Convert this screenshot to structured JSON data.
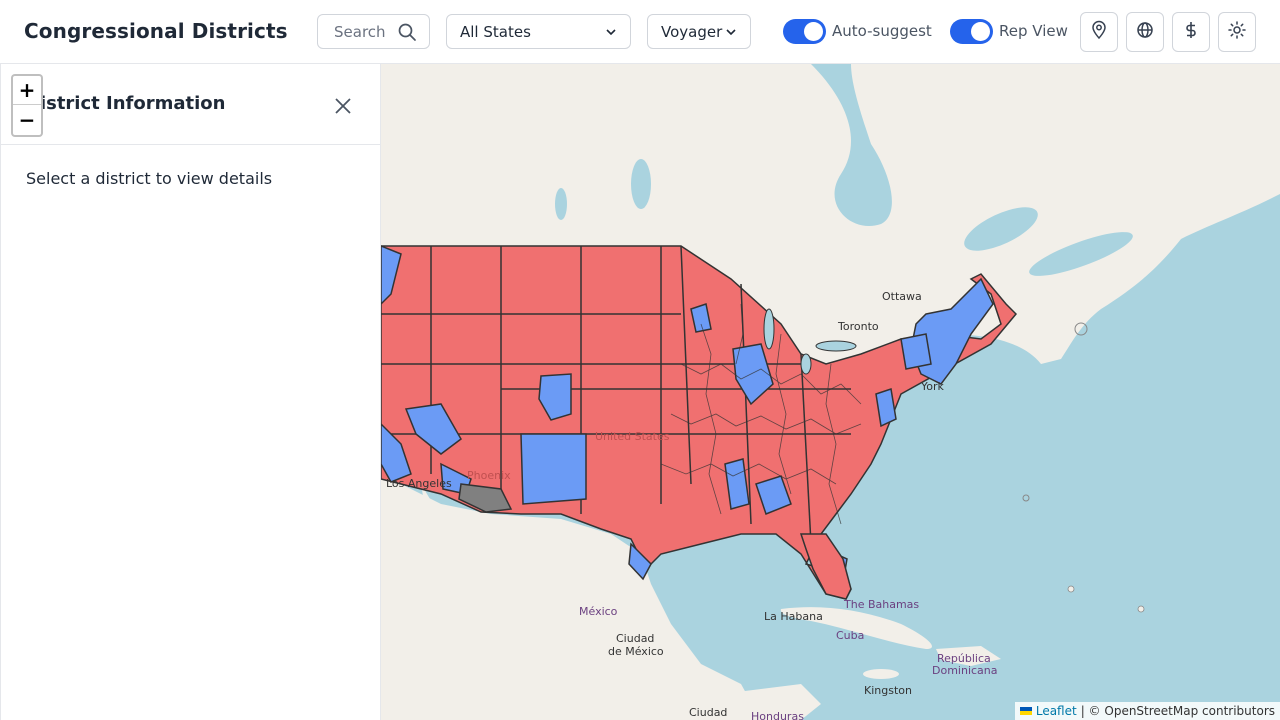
{
  "header": {
    "title": "Congressional Districts",
    "search_placeholder": "Search",
    "state_select": "All States",
    "basemap_select": "Voyager",
    "toggle_autosuggest": "Auto-suggest",
    "toggle_repview": "Rep View",
    "icons": [
      "map-pin-icon",
      "globe-icon",
      "dollar-icon",
      "sun-icon"
    ]
  },
  "sidebar": {
    "title": "District Information",
    "empty_text": "Select a district to view details",
    "zoom_in": "+",
    "zoom_out": "−"
  },
  "map": {
    "labels": {
      "ottawa": "Ottawa",
      "toronto": "Toronto",
      "new_york": "York",
      "united_states": "United States",
      "phoenix": "Phoenix",
      "los_angeles": "Los Angeles",
      "mexico": "México",
      "ciudad_mexico_1": "Ciudad",
      "ciudad_mexico_2": "de México",
      "la_habana": "La Habana",
      "cuba": "Cuba",
      "bahamas": "The Bahamas",
      "republica": "República",
      "dominicana": "Dominicana",
      "kingston": "Kingston",
      "ciudad_bottom": "Ciudad",
      "honduras": "Honduras"
    },
    "colors": {
      "republican": "#f07070",
      "democrat": "#6b9bf5",
      "vacant": "#808080",
      "water": "#aad3df",
      "land": "#f2efe9"
    },
    "attribution": {
      "leaflet": "Leaflet",
      "osm": "| © OpenStreetMap contributors"
    }
  }
}
